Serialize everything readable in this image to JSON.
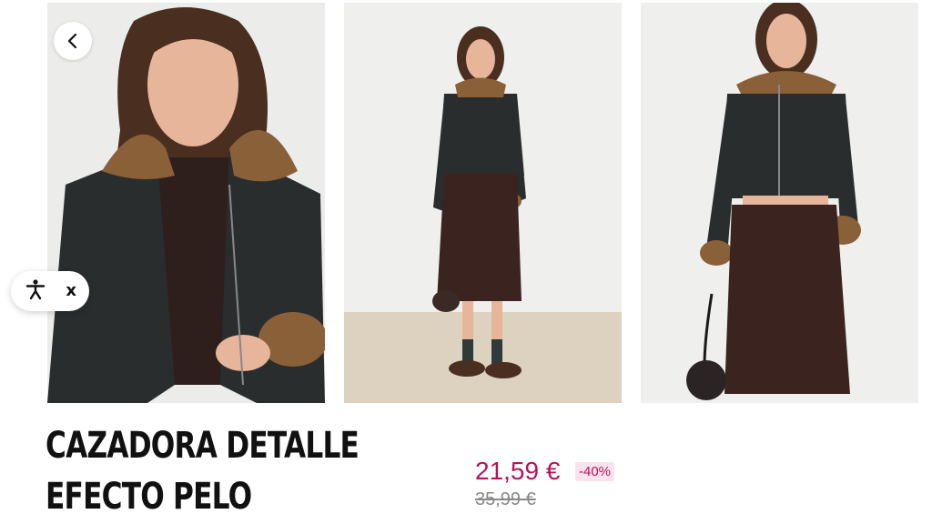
{
  "product": {
    "title_line1": "CAZADORA DETALLE",
    "title_line2": "EFECTO PELO",
    "price_current": "21,59 €",
    "discount_badge": "-40%",
    "price_original": "35,99 €"
  },
  "gallery": {
    "images": [
      {
        "name": "product-photo-closeup"
      },
      {
        "name": "product-photo-fullbody"
      },
      {
        "name": "product-photo-three-quarter"
      }
    ]
  },
  "controls": {
    "back_icon": "chevron-left-icon",
    "accessibility_icon": "accessibility-icon",
    "close_label": "x"
  },
  "colors": {
    "accent_price": "#b5135a",
    "discount_bg": "#fbe3ee",
    "old_price": "#888888"
  }
}
